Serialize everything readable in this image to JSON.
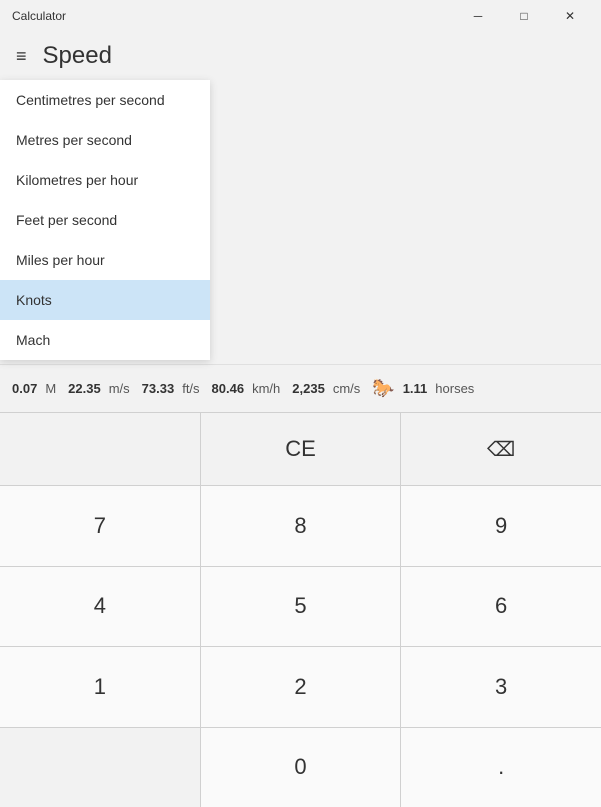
{
  "titleBar": {
    "title": "Calculator",
    "minimizeLabel": "─",
    "maximizeLabel": "□",
    "closeLabel": "✕"
  },
  "header": {
    "hamburgerIcon": "≡",
    "title": "Speed"
  },
  "dropdown": {
    "triggerText": "— —",
    "items": [
      {
        "label": "Centimetres per second",
        "selected": false
      },
      {
        "label": "Metres per second",
        "selected": false
      },
      {
        "label": "Kilometres per hour",
        "selected": false
      },
      {
        "label": "Feet per second",
        "selected": false
      },
      {
        "label": "Miles per hour",
        "selected": false
      },
      {
        "label": "Knots",
        "selected": true
      },
      {
        "label": "Mach",
        "selected": false
      }
    ]
  },
  "speedBar": {
    "values": [
      {
        "num": "0.07",
        "unit": "M"
      },
      {
        "num": "22.35",
        "unit": "m/s"
      },
      {
        "num": "73.33",
        "unit": "ft/s"
      },
      {
        "num": "80.46",
        "unit": "km/h"
      },
      {
        "num": "2,235",
        "unit": "cm/s"
      },
      {
        "horse": "🐎",
        "num": "1.11",
        "unit": "horses"
      }
    ]
  },
  "calculator": {
    "ceLabel": "CE",
    "backspaceIcon": "⌫",
    "buttons": [
      "7",
      "8",
      "9",
      "4",
      "5",
      "6",
      "1",
      "2",
      "3",
      "",
      "0",
      "."
    ]
  }
}
